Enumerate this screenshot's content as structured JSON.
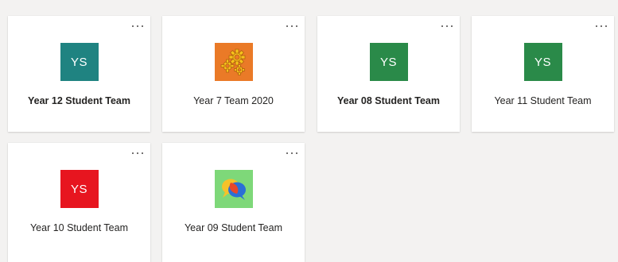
{
  "teams": [
    {
      "name": "Year 12 Student Team",
      "initials": "YS",
      "avatar_color": "#1f8381",
      "bold": true,
      "icon": "initials"
    },
    {
      "name": "Year 7 Team 2020",
      "initials": "",
      "avatar_color": "#ea7a27",
      "bold": false,
      "icon": "gears-icon"
    },
    {
      "name": "Year 08 Student Team",
      "initials": "YS",
      "avatar_color": "#2a8a49",
      "bold": true,
      "icon": "initials"
    },
    {
      "name": "Year 11 Student Team",
      "initials": "YS",
      "avatar_color": "#2a8a49",
      "bold": false,
      "icon": "initials"
    },
    {
      "name": "Year 10 Student Team",
      "initials": "YS",
      "avatar_color": "#e7151f",
      "bold": false,
      "icon": "initials"
    },
    {
      "name": "Year 09 Student Team",
      "initials": "",
      "avatar_color": "#7ed879",
      "bold": false,
      "icon": "speech-bubbles-icon"
    }
  ]
}
